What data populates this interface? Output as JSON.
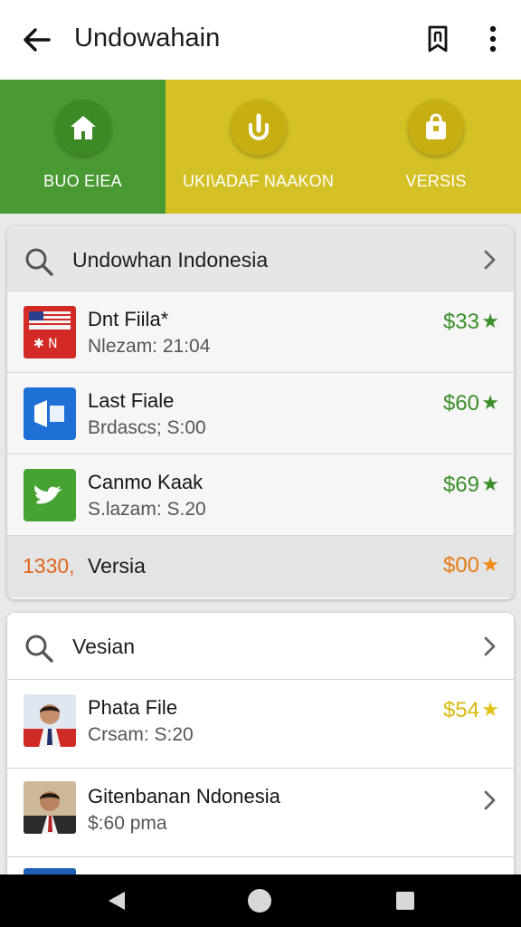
{
  "appbar": {
    "title": "Undowahain",
    "back_icon": "arrow-back-icon",
    "bookmark_icon": "bookmark-icon",
    "more_icon": "more-vert-icon"
  },
  "categories": [
    {
      "label": "BUO EIEA",
      "icon": "home-icon",
      "color": "#4a9a33"
    },
    {
      "label": "UKI\\ADAF NAAKON",
      "icon": "touch-icon",
      "color": "#d3c125"
    },
    {
      "label": "VERSIS",
      "icon": "bag-icon",
      "color": "#d3c125"
    }
  ],
  "card1": {
    "title": "Undowhan Indonesia",
    "items": [
      {
        "name": "Dnt Fiila*",
        "sub": "Nlezam: 21:04",
        "price": "$33",
        "price_color": "#3b8f2b"
      },
      {
        "name": "Last Fiale",
        "sub": "Brdascs; S:00",
        "price": "$60",
        "price_color": "#3b8f2b"
      },
      {
        "name": "Canmo Kaak",
        "sub": "S.lazam: S.20",
        "price": "$69",
        "price_color": "#3b8f2b"
      }
    ],
    "summary": {
      "count": "1330,",
      "label": "Versia",
      "price": "$00"
    }
  },
  "card2": {
    "title": "Vesian",
    "items": [
      {
        "name": "Phata File",
        "sub": "Crsam: S:20",
        "price": "$54"
      },
      {
        "name": "Gitenbanan Ndonesia",
        "sub": "$:60 pma"
      }
    ]
  },
  "navbar": {
    "back": "nav-back-icon",
    "home": "nav-home-icon",
    "recents": "nav-recents-icon"
  }
}
